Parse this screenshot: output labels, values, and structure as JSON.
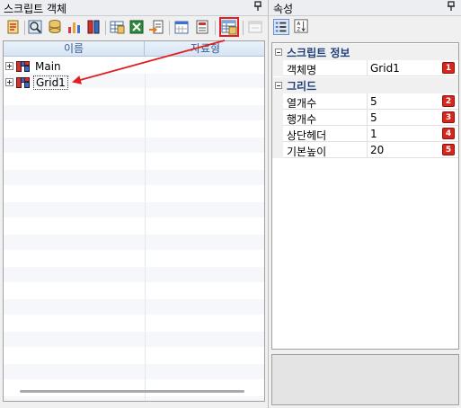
{
  "left_panel": {
    "title": "스크립트 객체",
    "pin_glyph": "ᴘ",
    "toolbar": {
      "buttons": [
        {
          "name": "toolbar-btn-1",
          "icon": "script-add-icon"
        },
        {
          "name": "toolbar-btn-2",
          "icon": "form-icon"
        },
        {
          "name": "toolbar-btn-3",
          "icon": "database-icon"
        },
        {
          "name": "toolbar-btn-4",
          "icon": "chart-icon"
        },
        {
          "name": "toolbar-btn-5",
          "icon": "table-icon"
        },
        {
          "name": "toolbar-btn-6",
          "icon": "grid-icon"
        },
        {
          "name": "toolbar-btn-7",
          "icon": "excel-icon"
        },
        {
          "name": "toolbar-btn-8",
          "icon": "export-icon"
        },
        {
          "name": "toolbar-btn-9",
          "icon": "calendar-icon"
        },
        {
          "name": "toolbar-btn-10",
          "icon": "report-icon"
        },
        {
          "name": "toolbar-btn-11",
          "icon": "grid-add-icon",
          "selected": true
        },
        {
          "name": "toolbar-btn-12",
          "icon": "window-icon",
          "disabled": true
        }
      ]
    },
    "columns": {
      "name": "이름",
      "type": "자료형"
    },
    "tree": [
      {
        "label": "Main",
        "type": ""
      },
      {
        "label": "Grid1",
        "type": "",
        "focused": true
      }
    ]
  },
  "right_panel": {
    "title": "속성",
    "pin_glyph": "ᴘ",
    "toolbar": [
      {
        "name": "categorized-view-button",
        "icon": "list-icon",
        "active": true
      },
      {
        "name": "alphabetical-view-button",
        "icon": "sort-az-icon",
        "active": false
      }
    ],
    "categories": [
      {
        "name": "스크립트 정보",
        "properties": [
          {
            "name": "객체명",
            "value": "Grid1",
            "badge": "1"
          }
        ]
      },
      {
        "name": "그리드",
        "properties": [
          {
            "name": "열개수",
            "value": "5",
            "badge": "2"
          },
          {
            "name": "행개수",
            "value": "5",
            "badge": "3"
          },
          {
            "name": "상단헤더",
            "value": "1",
            "badge": "4"
          },
          {
            "name": "기본높이",
            "value": "20",
            "badge": "5"
          }
        ]
      }
    ]
  },
  "colors": {
    "highlight_red": "#e02020",
    "badge_red": "#d7261e",
    "category_text": "#1f3f7a",
    "header_text": "#3a5f8f"
  }
}
